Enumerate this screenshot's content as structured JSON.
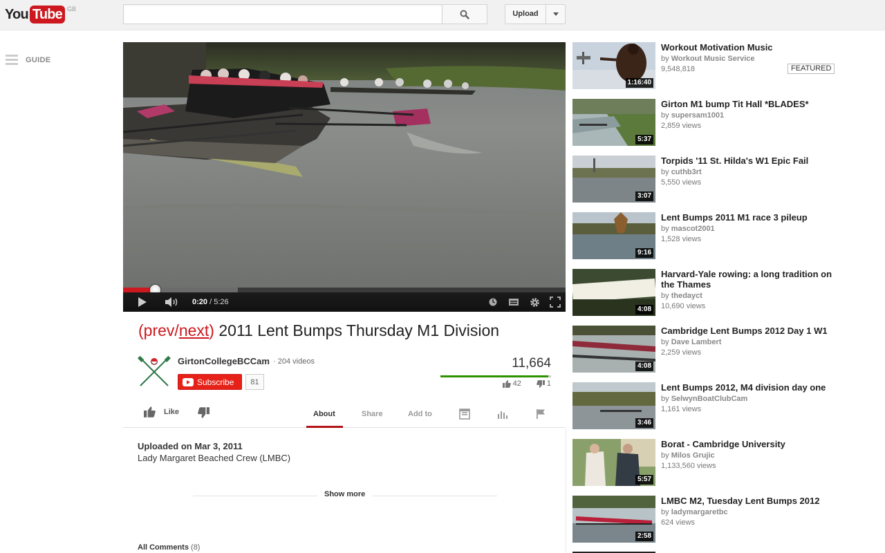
{
  "masthead": {
    "logo_you": "You",
    "logo_tube": "Tube",
    "country": "GB",
    "search_placeholder": "",
    "upload_label": "Upload"
  },
  "guide": {
    "label": "GUIDE"
  },
  "player": {
    "current_time": "0:20",
    "duration": "5:26",
    "played_fraction": 0.0613,
    "buffered_fraction": 0.26
  },
  "video": {
    "title_prev": "prev",
    "title_next": "next",
    "title_rest": " 2011 Lent Bumps Thursday M1 Division",
    "channel": "GirtonCollegeBCCam",
    "video_count": "204 videos",
    "subscribe_label": "Subscribe",
    "subscriber_count": "81",
    "views": "11,664",
    "likes": "42",
    "dislikes": "1",
    "like_label": "Like",
    "tabs": [
      "About",
      "Share",
      "Add to"
    ],
    "uploaded": "Uploaded on Mar 3, 2011",
    "description": "Lady Margaret Beached Crew (LMBC)",
    "show_more": "Show more",
    "comments_label": "All Comments",
    "comments_count": "(8)"
  },
  "related": [
    {
      "title": "Workout Motivation Music",
      "by": "Workout Music Service",
      "views": "9,548,818",
      "duration": "1:16:40",
      "badge": "FEATURED"
    },
    {
      "title": "Girton M1 bump Tit Hall *BLADES*",
      "by": "supersam1001",
      "views": "2,859 views",
      "duration": "5:37"
    },
    {
      "title": "Torpids '11 St. Hilda's W1 Epic Fail",
      "by": "cuthb3rt",
      "views": "5,550 views",
      "duration": "3:07"
    },
    {
      "title": "Lent Bumps 2011 M1 race 3 pileup",
      "by": "mascot2001",
      "views": "1,528 views",
      "duration": "9:16"
    },
    {
      "title": "Harvard-Yale rowing: a long tradition on the Thames",
      "by": "thedayct",
      "views": "10,690 views",
      "duration": "4:08"
    },
    {
      "title": "Cambridge Lent Bumps 2012 Day 1 W1",
      "by": "Dave Lambert",
      "views": "2,259 views",
      "duration": "4:08"
    },
    {
      "title": "Lent Bumps 2012, M4 division day one",
      "by": "SelwynBoatClubCam",
      "views": "1,161 views",
      "duration": "3:46"
    },
    {
      "title": "Borat - Cambridge University",
      "by": "Milos Grujic",
      "views": "1,133,560 views",
      "duration": "5:57"
    },
    {
      "title": "LMBC M2, Tuesday Lent Bumps 2012",
      "by": "ladymargaretbc",
      "views": "624 views",
      "duration": "2:58"
    }
  ],
  "by_prefix": "by ",
  "colors": {
    "brand_red": "#cc181e",
    "like_green": "#2e9200"
  }
}
